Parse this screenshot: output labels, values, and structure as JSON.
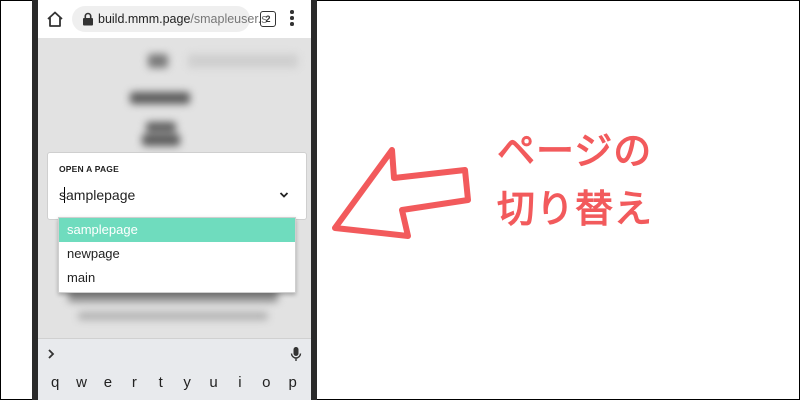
{
  "browser": {
    "url_domain": "build.mmm.page",
    "url_path": "/smapleuser.s",
    "tab_count": "2"
  },
  "picker": {
    "label": "OPEN A PAGE",
    "selected_value": "samplepage",
    "options": [
      "samplepage",
      "newpage",
      "main"
    ],
    "selected_color": "#6fdcbe"
  },
  "keyboard": {
    "row1": [
      "q",
      "w",
      "e",
      "r",
      "t",
      "y",
      "u",
      "i",
      "o",
      "p"
    ]
  },
  "annotation": {
    "line1": "ページの",
    "line2": "切り替え",
    "color": "#f25a5c"
  }
}
